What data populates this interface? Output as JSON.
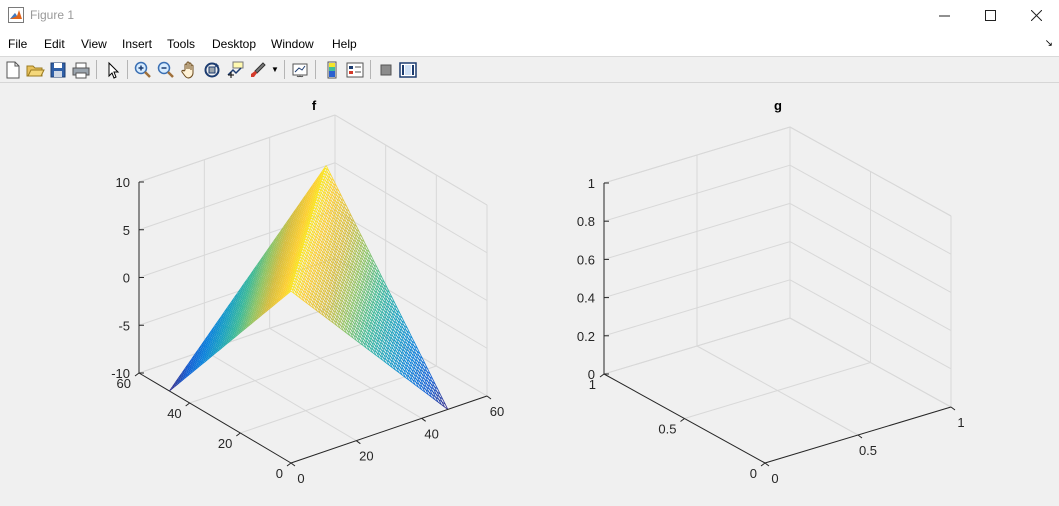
{
  "window": {
    "title": "Figure 1"
  },
  "menu": [
    {
      "label": "File"
    },
    {
      "label": "Edit"
    },
    {
      "label": "View"
    },
    {
      "label": "Insert"
    },
    {
      "label": "Tools"
    },
    {
      "label": "Desktop"
    },
    {
      "label": "Window"
    },
    {
      "label": "Help"
    }
  ],
  "toolbar": {
    "icons": [
      "new-figure-icon",
      "open-file-icon",
      "save-icon",
      "print-icon",
      "edit-plot-icon",
      "zoom-in-icon",
      "zoom-out-icon",
      "pan-icon",
      "rotate-3d-icon",
      "data-cursor-icon",
      "brush-icon",
      "link-plot-icon",
      "insert-colorbar-icon",
      "insert-legend-icon",
      "hide-plot-tools-icon",
      "show-plot-tools-icon"
    ]
  },
  "chart_data": [
    {
      "type": "surface",
      "title": "f",
      "xlabel": "",
      "ylabel": "",
      "zlabel": "",
      "xlim": [
        0,
        60
      ],
      "ylim": [
        0,
        60
      ],
      "zlim": [
        -10,
        10
      ],
      "xticks": [
        "0",
        "20",
        "40",
        "60"
      ],
      "yticks": [
        "0",
        "20",
        "40",
        "60"
      ],
      "zticks": [
        "-10",
        "-5",
        "0",
        "5",
        "10"
      ],
      "grid": true,
      "colormap": "parula",
      "surface": {
        "grid_size": 49,
        "xy_range": [
          0,
          48
        ],
        "description_values": "z varies from about -10 at the x,y corners to about 8 at the apex"
      }
    },
    {
      "type": "surface",
      "title": "g",
      "xlabel": "",
      "ylabel": "",
      "zlabel": "",
      "xlim": [
        0,
        1
      ],
      "ylim": [
        0,
        1
      ],
      "zlim": [
        0,
        1
      ],
      "xticks": [
        "0",
        "0.5",
        "1"
      ],
      "yticks": [
        "0",
        "0.5",
        "1"
      ],
      "zticks": [
        "0",
        "0.2",
        "0.4",
        "0.6",
        "0.8",
        "1"
      ],
      "grid": true,
      "empty": true
    }
  ]
}
